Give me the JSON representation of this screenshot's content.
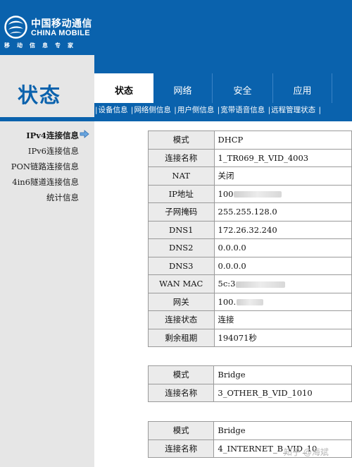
{
  "brand": {
    "name_cn": "中国移动通信",
    "name_en": "CHINA MOBILE",
    "slogan": "移动信息专家"
  },
  "page_title": "状态",
  "tabs": [
    {
      "label": "状态",
      "active": true
    },
    {
      "label": "网络",
      "active": false
    },
    {
      "label": "安全",
      "active": false
    },
    {
      "label": "应用",
      "active": false
    }
  ],
  "subnav": [
    "设备信息",
    "网络侧信息",
    "用户侧信息",
    "宽带语音信息",
    "远程管理状态"
  ],
  "sidebar": [
    {
      "label": "IPv4连接信息",
      "active": true
    },
    {
      "label": "IPv6连接信息",
      "active": false
    },
    {
      "label": "PON链路连接信息",
      "active": false
    },
    {
      "label": "4in6隧道连接信息",
      "active": false
    },
    {
      "label": "统计信息",
      "active": false
    }
  ],
  "tables": [
    {
      "rows": [
        {
          "key": "模式",
          "value": "DHCP"
        },
        {
          "key": "连接名称",
          "value": "1_TR069_R_VID_4003"
        },
        {
          "key": "NAT",
          "value": "关闭"
        },
        {
          "key": "IP地址",
          "value": "100"
        },
        {
          "key": "子网掩码",
          "value": "255.255.128.0"
        },
        {
          "key": "DNS1",
          "value": "172.26.32.240"
        },
        {
          "key": "DNS2",
          "value": "0.0.0.0"
        },
        {
          "key": "DNS3",
          "value": "0.0.0.0"
        },
        {
          "key": "WAN MAC",
          "value": "5c:3"
        },
        {
          "key": "网关",
          "value": "100."
        },
        {
          "key": "连接状态",
          "value": "连接"
        },
        {
          "key": "剩余租期",
          "value": "194071秒"
        }
      ]
    },
    {
      "rows": [
        {
          "key": "模式",
          "value": "Bridge"
        },
        {
          "key": "连接名称",
          "value": "3_OTHER_B_VID_1010"
        }
      ]
    },
    {
      "rows": [
        {
          "key": "模式",
          "value": "Bridge"
        },
        {
          "key": "连接名称",
          "value": "4_INTERNET_B_VID_10"
        }
      ]
    }
  ],
  "watermark": "知乎 @海斌",
  "colors": {
    "brand_blue": "#0a62ad",
    "sidebar_grey": "#e6e6e6",
    "key_cell_bg": "#ebebeb"
  }
}
